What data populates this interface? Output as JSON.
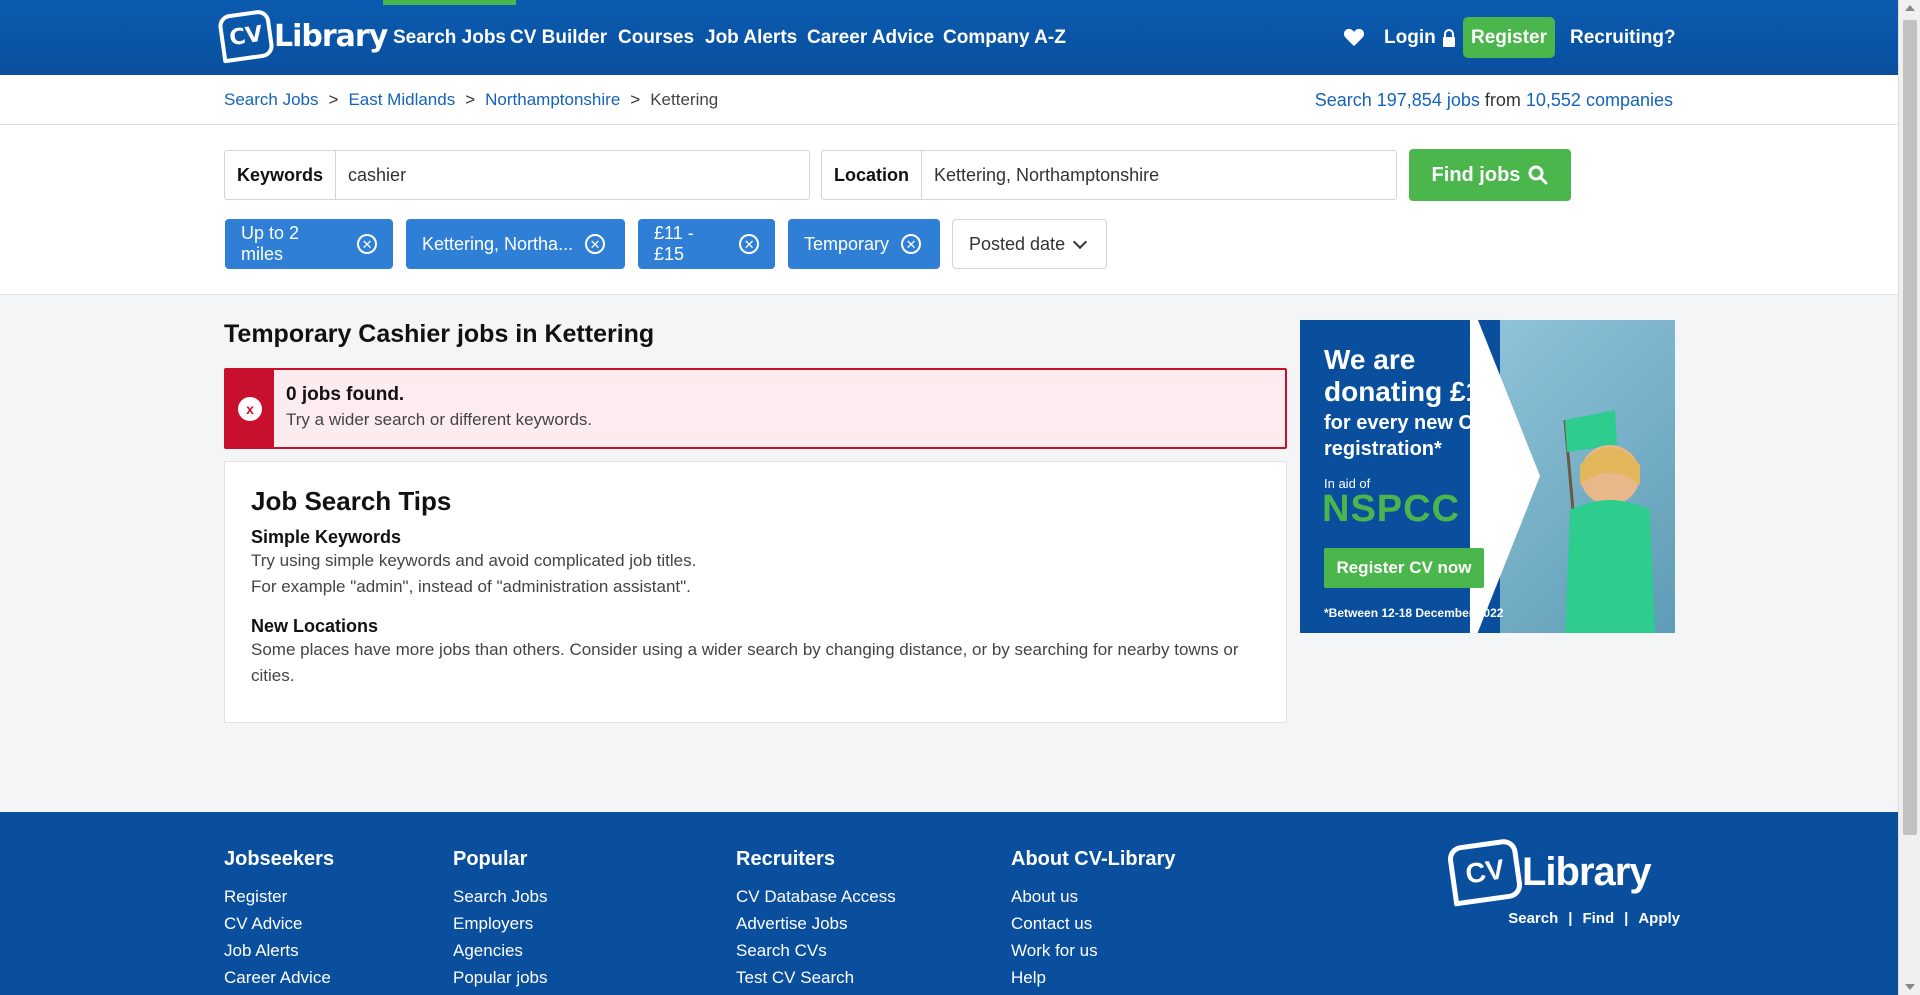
{
  "header": {
    "logo_cv": "CV",
    "logo_text": "Library",
    "nav": [
      "Search Jobs",
      "CV Builder",
      "Courses",
      "Job Alerts",
      "Career Advice",
      "Company A-Z"
    ],
    "login": "Login",
    "register": "Register",
    "recruiting": "Recruiting?"
  },
  "breadcrumb": {
    "items": [
      "Search Jobs",
      "East Midlands",
      "Northamptonshire"
    ],
    "current": "Kettering",
    "separator": ">"
  },
  "stats": {
    "prefix": "Search",
    "jobs_count": "197,854 jobs",
    "middle": "from",
    "companies_count": "10,552 companies"
  },
  "search": {
    "keywords_label": "Keywords",
    "keywords_value": "cashier",
    "location_label": "Location",
    "location_value": "Kettering, Northamptonshire",
    "find_button": "Find jobs"
  },
  "filters": {
    "chips": [
      "Up to 2 miles",
      "Kettering, Northa...",
      "£11 - £15",
      "Temporary"
    ],
    "chip_close": "✕",
    "sort_label": "Posted date"
  },
  "results": {
    "title": "Temporary Cashier jobs in Kettering",
    "alert_icon": "x",
    "alert_title": "0 jobs found.",
    "alert_message": "Try a wider search or different keywords."
  },
  "tips": {
    "title": "Job Search Tips",
    "items": [
      {
        "heading": "Simple Keywords",
        "lines": [
          "Try using simple keywords and avoid complicated job titles.",
          "For example \"admin\", instead of \"administration assistant\"."
        ]
      },
      {
        "heading": "New Locations",
        "lines": [
          "Some places have more jobs than others. Consider using a wider search by changing distance, or by searching for nearby towns or cities."
        ]
      }
    ]
  },
  "ad": {
    "line1": "We are donating £1",
    "line2": "for every new CV registration*",
    "in_aid": "In aid of",
    "charity": "NSPCC",
    "button": "Register CV now",
    "note": "*Between 12-18 December 2022"
  },
  "footer": {
    "columns": [
      {
        "title": "Jobseekers",
        "links": [
          "Register",
          "CV Advice",
          "Job Alerts",
          "Career Advice"
        ]
      },
      {
        "title": "Popular",
        "links": [
          "Search Jobs",
          "Employers",
          "Agencies",
          "Popular jobs"
        ]
      },
      {
        "title": "Recruiters",
        "links": [
          "CV Database Access",
          "Advertise Jobs",
          "Search CVs",
          "Test CV Search"
        ]
      },
      {
        "title": "About CV-Library",
        "links": [
          "About us",
          "Contact us",
          "Work for us",
          "Help"
        ]
      }
    ],
    "logo_cv": "CV",
    "logo_text": "Library",
    "tagline": [
      "Search",
      "Find",
      "Apply"
    ],
    "tagline_sep": "|"
  },
  "colors": {
    "brand_blue": "#0a4f9e",
    "accent_green": "#4ab64b",
    "chip_blue": "#2f7fd6",
    "error_red": "#c8102e"
  }
}
